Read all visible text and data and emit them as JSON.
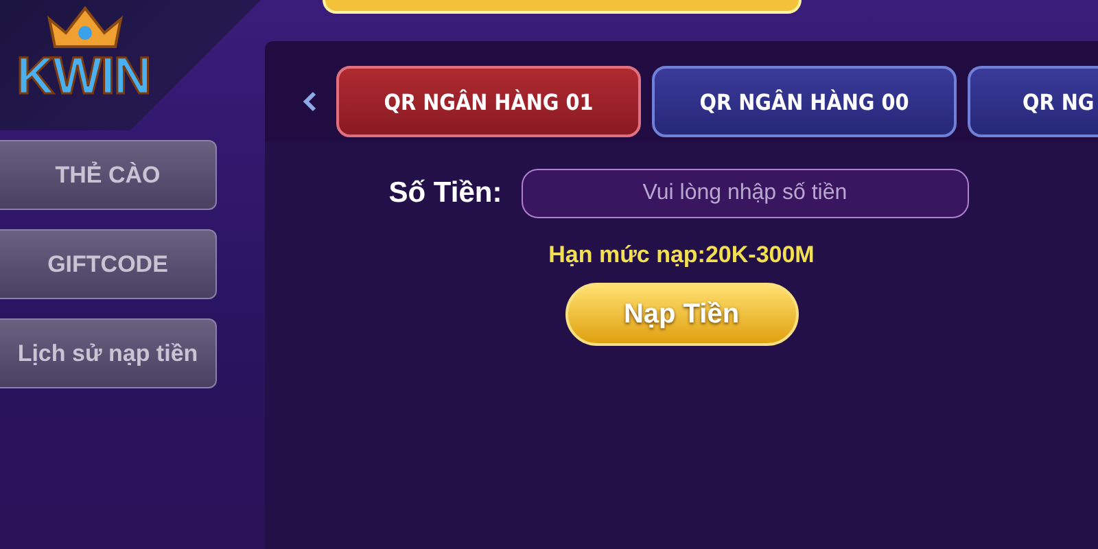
{
  "logo": {
    "text": "KWIN"
  },
  "sidebar": {
    "items": [
      {
        "label": "THẺ CÀO",
        "selected": false
      },
      {
        "label": "GIFTCODE",
        "selected": false
      },
      {
        "label": "Lịch sử nạp tiền",
        "selected": false
      }
    ]
  },
  "tabs": [
    {
      "label": "QR NGÂN HÀNG 01",
      "selected": true
    },
    {
      "label": "QR NGÂN HÀNG 00",
      "selected": false
    },
    {
      "label": "QR NG",
      "selected": false
    }
  ],
  "form": {
    "amount_label": "Số Tiền:",
    "amount_placeholder": "Vui lòng nhập số tiền",
    "limit": "Hạn mức nạp:20K-300M",
    "submit": "Nạp Tiền"
  }
}
